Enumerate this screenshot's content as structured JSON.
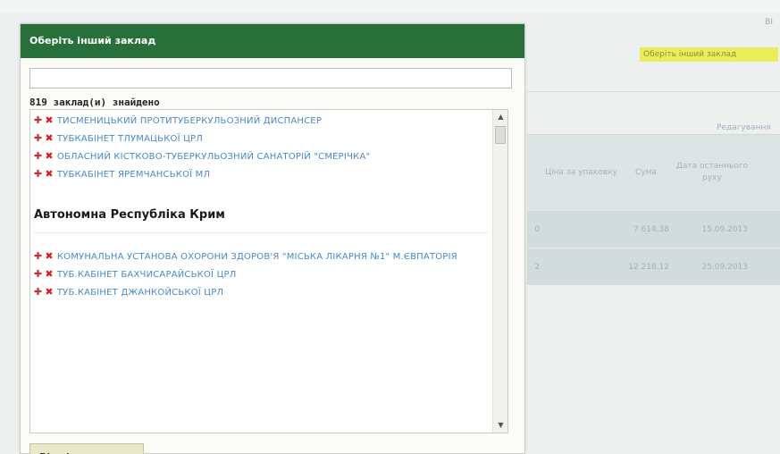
{
  "background": {
    "top_right_text": "ВІ",
    "highlight_link": "Оберіть інший заклад",
    "edit_link": "Редагування",
    "table": {
      "headers": [
        "",
        "Ціна за упаковку",
        "Сума",
        "Дата останнього руху"
      ],
      "rows": [
        {
          "qty_tail": "0",
          "price": "",
          "sum": "7 614,38",
          "date": "15.09.2013"
        },
        {
          "qty_tail": "2",
          "price": "",
          "sum": "12 218,12",
          "date": "25.09.2013"
        }
      ]
    }
  },
  "dialog": {
    "title": "Оберіть інший заклад",
    "search": {
      "value": "",
      "placeholder": ""
    },
    "found_count": "819 заклад(и) знайдено",
    "items_before": [
      "ТИСМЕНИЦЬКИЙ ПРОТИТУБЕРКУЛЬОЗНИЙ ДИСПАНСЕР",
      "ТУБКАБІНЕТ ТЛУМАЦЬКОЇ ЦРЛ",
      "ОБЛАСНИЙ КІСТКОВО-ТУБЕРКУЛЬОЗНИЙ САНАТОРІЙ \"СМЕРІЧКА\"",
      "ТУБКАБІНЕТ ЯРЕМЧАНСЬКОЇ МЛ"
    ],
    "region_heading": "Автономна Республіка Крим",
    "items_after": [
      "КОМУНАЛЬНА УСТАНОВА ОХОРОНИ ЗДОРОВ'Я \"МІСЬКА ЛІКАРНЯ №1\" М.ЄВПАТОРІЯ",
      "ТУБ.КАБІНЕТ БАХЧИСАРАЙСЬКОЇ ЦРЛ",
      "ТУБ.КАБІНЕТ ДЖАНКОЙСЬКОЇ ЦРЛ"
    ],
    "icons": {
      "add": "plus-icon",
      "remove": "x-icon"
    },
    "cancel_label": "Відміни"
  },
  "colors": {
    "title_bar": "#28703a",
    "link": "#4a88c4",
    "highlight": "#e9ee5a"
  }
}
